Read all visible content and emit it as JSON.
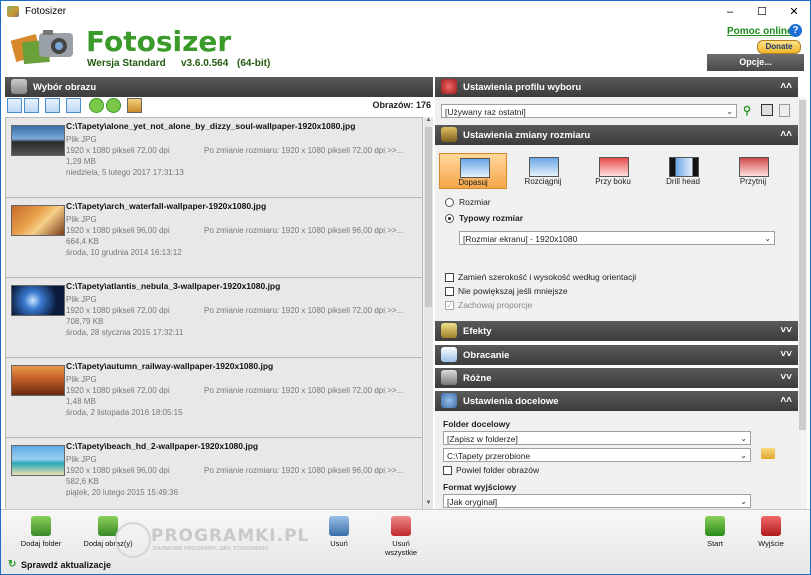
{
  "window": {
    "title": "Fotosizer"
  },
  "header": {
    "brand": "Fotosizer",
    "edition": "Wersja Standard",
    "version": "v3.6.0.564",
    "bits": "(64-bit)",
    "help_link": "Pomoc online",
    "help_icon": "?",
    "donate": "Donate",
    "options": "Opcje..."
  },
  "left_panel": {
    "title": "Wybór obrazu",
    "count_label": "Obrazów: 176",
    "items": [
      {
        "path": "C:\\Tapety\\alone_yet_not_alone_by_dizzy_soul-wallpaper-1920x1080.jpg",
        "type": "Plik JPG",
        "dims": "1920 x 1080 pikseli 72,00 dpi",
        "after": "Po zmianie rozmiaru: 1920 x 1080 pikseli 72,00 dpi >>...",
        "size": "1,29 MB",
        "date": "niedziela, 5 lutego 2017 17:31:13"
      },
      {
        "path": "C:\\Tapety\\arch_waterfall-wallpaper-1920x1080.jpg",
        "type": "Plik JPG",
        "dims": "1920 x 1080 pikseli 96,00 dpi",
        "after": "Po zmianie rozmiaru: 1920 x 1080 pikseli 96,00 dpi >>...",
        "size": "664,4 KB",
        "date": "środa, 10 grudnia 2014 16:13:12"
      },
      {
        "path": "C:\\Tapety\\atlantis_nebula_3-wallpaper-1920x1080.jpg",
        "type": "Plik JPG",
        "dims": "1920 x 1080 pikseli 72,00 dpi",
        "after": "Po zmianie rozmiaru: 1920 x 1080 pikseli 72,00 dpi >>...",
        "size": "708,79 KB",
        "date": "środa, 28 stycznia 2015 17:32:11"
      },
      {
        "path": "C:\\Tapety\\autumn_railway-wallpaper-1920x1080.jpg",
        "type": "Plik JPG",
        "dims": "1920 x 1080 pikseli 72,00 dpi",
        "after": "Po zmianie rozmiaru: 1920 x 1080 pikseli 72,00 dpi >>...",
        "size": "1,48 MB",
        "date": "środa, 2 listopada 2016 18:05:15"
      },
      {
        "path": "C:\\Tapety\\beach_hd_2-wallpaper-1920x1080.jpg",
        "type": "Plik JPG",
        "dims": "1920 x 1080 pikseli 96,00 dpi",
        "after": "Po zmianie rozmiaru: 1920 x 1080 pikseli 96,00 dpi >>...",
        "size": "582,6 KB",
        "date": "piątek, 20 lutego 2015 15:49:36"
      }
    ]
  },
  "profile": {
    "title": "Ustawienia profilu wyboru",
    "selected": "[Używany raz ostatni]"
  },
  "resize": {
    "title": "Ustawienia zmiany rozmiaru",
    "modes": [
      {
        "label": "Dopasuj"
      },
      {
        "label": "Rozciągnij"
      },
      {
        "label": "Przy boku"
      },
      {
        "label": "Drill head"
      },
      {
        "label": "Przytnij"
      }
    ],
    "radio_size": "Rozmiar",
    "radio_typical": "Typowy rozmiar",
    "typical_selected": "[Rozmiar ekranu] - 1920x1080",
    "cb_swap": "Zamień szerokość i wysokość według orientacji",
    "cb_noenlarge": "Nie powiększaj jeśli mniejsze",
    "cb_keep": "Zachowaj proporcje",
    "cb_keep_mark": "✓"
  },
  "sections": {
    "effects": "Efekty",
    "rotate": "Obracanie",
    "misc": "Różne",
    "target": "Ustawienia docelowe"
  },
  "target": {
    "folder_label": "Folder docelowy",
    "folder_mode": "[Zapisz w folderze]",
    "folder_path": "C:\\Tapety przerobione",
    "cb_repeat": "Powiel folder obrazów",
    "format_label": "Format wyjściowy",
    "format_selected": "[Jak oryginał]"
  },
  "bottom": {
    "add_folder": "Dodaj folder",
    "add_images": "Dodaj obraz(y)",
    "remove": "Usuń",
    "remove_all": "Usuń wszystkie",
    "start": "Start",
    "exit": "Wyjście",
    "update": "Sprawdź aktualizacje",
    "watermark_main": "PROGRAMKI.PL",
    "watermark_sub": "DARMOWE PROGRAMY, GRY, STEROWNIKI"
  }
}
